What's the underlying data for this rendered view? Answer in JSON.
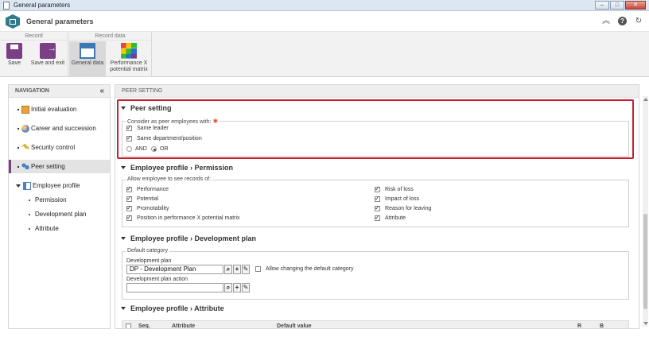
{
  "window": {
    "title": "General parameters",
    "buttons": [
      "–",
      "□",
      "✕"
    ]
  },
  "app": {
    "title": "General parameters"
  },
  "ribbon": {
    "groups": [
      {
        "label": "Record",
        "buttons": [
          {
            "label": "Save"
          },
          {
            "label": "Save and exit"
          }
        ]
      },
      {
        "label": "Record data",
        "buttons": [
          {
            "label": "General data"
          },
          {
            "label": "Performance X potential matrix"
          }
        ]
      }
    ]
  },
  "navigation": {
    "header": "NAVIGATION",
    "items": [
      {
        "label": "Initial evaluation"
      },
      {
        "label": "Career and succession"
      },
      {
        "label": "Security control"
      },
      {
        "label": "Peer setting"
      },
      {
        "label": "Employee profile"
      }
    ],
    "subitems": [
      {
        "label": "Permission"
      },
      {
        "label": "Development plan"
      },
      {
        "label": "Attribute"
      }
    ]
  },
  "main": {
    "header": "PEER SETTING",
    "peer": {
      "title": "Peer setting",
      "legend": "Consider as peer employees with:",
      "options": [
        {
          "label": "Same leader",
          "checked": true
        },
        {
          "label": "Same department/position",
          "checked": true
        }
      ],
      "radios": [
        {
          "label": "AND",
          "selected": false
        },
        {
          "label": "OR",
          "selected": true
        }
      ]
    },
    "permission": {
      "title": "Employee profile › Permission",
      "legend": "Allow employee to see records of:",
      "left": [
        "Performance",
        "Potential",
        "Promotability",
        "Position in performance X potential matrix"
      ],
      "right": [
        "Risk of loss",
        "Impact of loss",
        "Reason for leaving",
        "Attribute"
      ]
    },
    "devplan": {
      "title": "Employee profile › Development plan",
      "legend": "Default category",
      "plan_label": "Development plan",
      "plan_value": "DP - Development Plan",
      "allow_change_label": "Allow changing the default category",
      "action_label": "Development plan action",
      "action_value": ""
    },
    "attribute": {
      "title": "Employee profile › Attribute",
      "columns": {
        "seq": "Seq.",
        "attribute": "Attribute",
        "default_value": "Default value",
        "r": "R",
        "b": "B"
      }
    }
  }
}
